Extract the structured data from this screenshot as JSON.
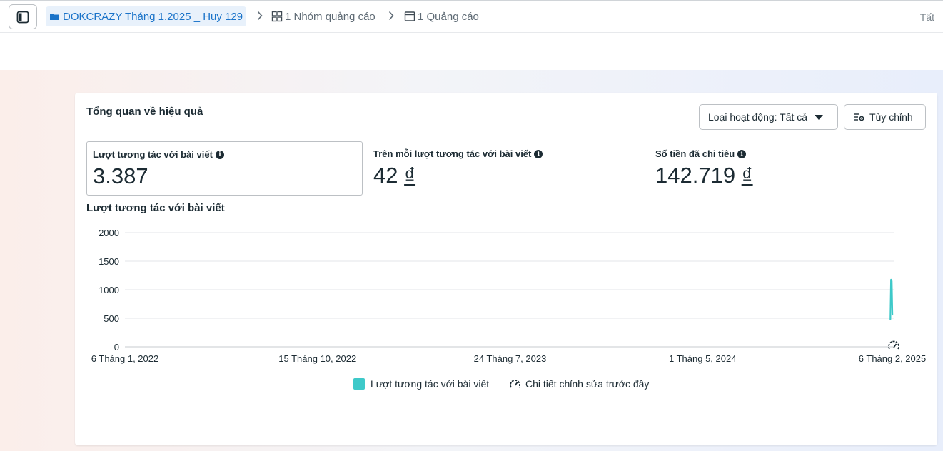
{
  "breadcrumb": {
    "campaign": "DOKCRAZY Tháng 1.2025 _ Huy 129",
    "adset": "1 Nhóm quảng cáo",
    "ad": "1 Quảng cáo"
  },
  "top_right_text": "Tất",
  "card": {
    "title": "Tổng quan về hiệu quả",
    "activity_button": "Loại hoạt động: Tất cả",
    "custom_button": "Tùy chỉnh"
  },
  "metrics": [
    {
      "label": "Lượt tương tác với bài viết",
      "value": "3.387",
      "currency": ""
    },
    {
      "label": "Trên mỗi lượt tương tác với bài viết",
      "value": "42",
      "currency": "₫"
    },
    {
      "label": "Số tiền đã chi tiêu",
      "value": "142.719",
      "currency": "₫"
    }
  ],
  "chart_title": "Lượt tương tác với bài viết",
  "chart_data": {
    "type": "line",
    "x_ticks": [
      "6 Tháng 1, 2022",
      "15 Tháng 10, 2022",
      "24 Tháng 7, 2023",
      "1 Tháng 5, 2024",
      "6 Tháng 2, 2025"
    ],
    "y_ticks": [
      0,
      500,
      1000,
      1500,
      2000
    ],
    "ylim": [
      0,
      2000
    ],
    "series": [
      {
        "name": "Lượt tương tác với bài viết",
        "color": "#3ec9c9",
        "points": [
          {
            "x": "2025-01-31",
            "y": 480
          },
          {
            "x": "2025-02-01",
            "y": 1180
          },
          {
            "x": "2025-02-02",
            "y": 1150
          },
          {
            "x": "2025-02-03",
            "y": 560
          }
        ]
      }
    ],
    "annotations": [
      {
        "x": "2025-02-06",
        "label": "Chi tiết chỉnh sửa trước đây"
      }
    ],
    "grid": true
  },
  "legend": {
    "series_label": "Lượt tương tác với bài viết",
    "edit_label": "Chi tiết chỉnh sửa trước đây"
  },
  "colors": {
    "accent": "#1a73c9",
    "series": "#3ec9c9"
  }
}
